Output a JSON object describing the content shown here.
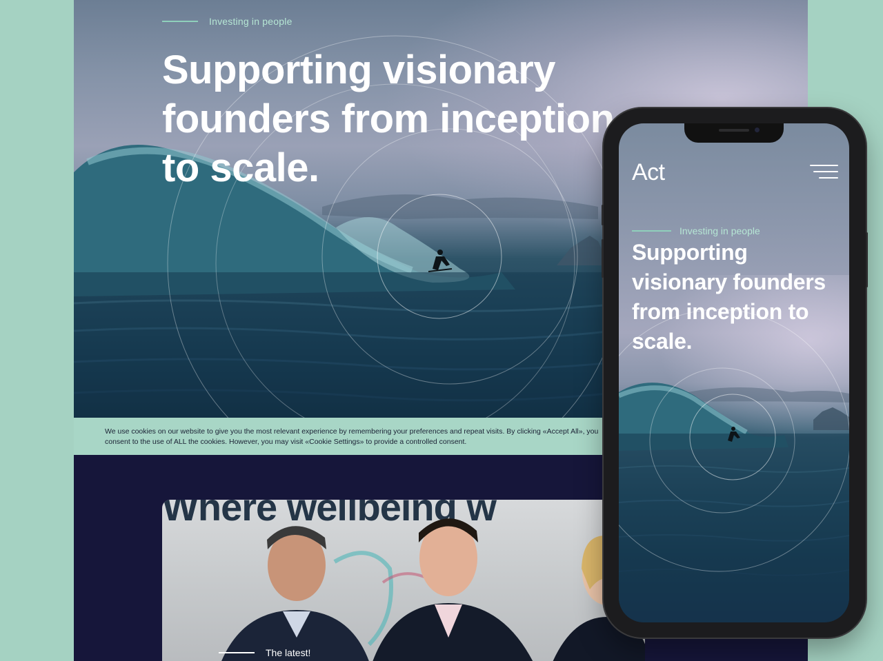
{
  "desktop": {
    "eyebrow": "Investing in people",
    "hero_title": "Supporting visionary founders from inception to scale.",
    "cookie_text": "We use cookies on our website to give you the most relevant experience by remembering your preferences and repeat visits. By clicking «Accept All», you consent to the use of ALL the cookies. However, you may visit «Cookie Settings» to provide a controlled consent.",
    "photo_banner": "Where wellbeing w",
    "latest_label": "The latest!"
  },
  "mobile": {
    "logo": "Act",
    "menu_icon": "hamburger-menu-icon",
    "eyebrow": "Investing in people",
    "hero_title": "Supporting visionary founders from inception to scale."
  },
  "colors": {
    "page_background": "#a5d2c2",
    "accent_mint": "#8fd0bb",
    "cookie_bar": "#a8d6c6",
    "dark_navy": "#16163a"
  }
}
